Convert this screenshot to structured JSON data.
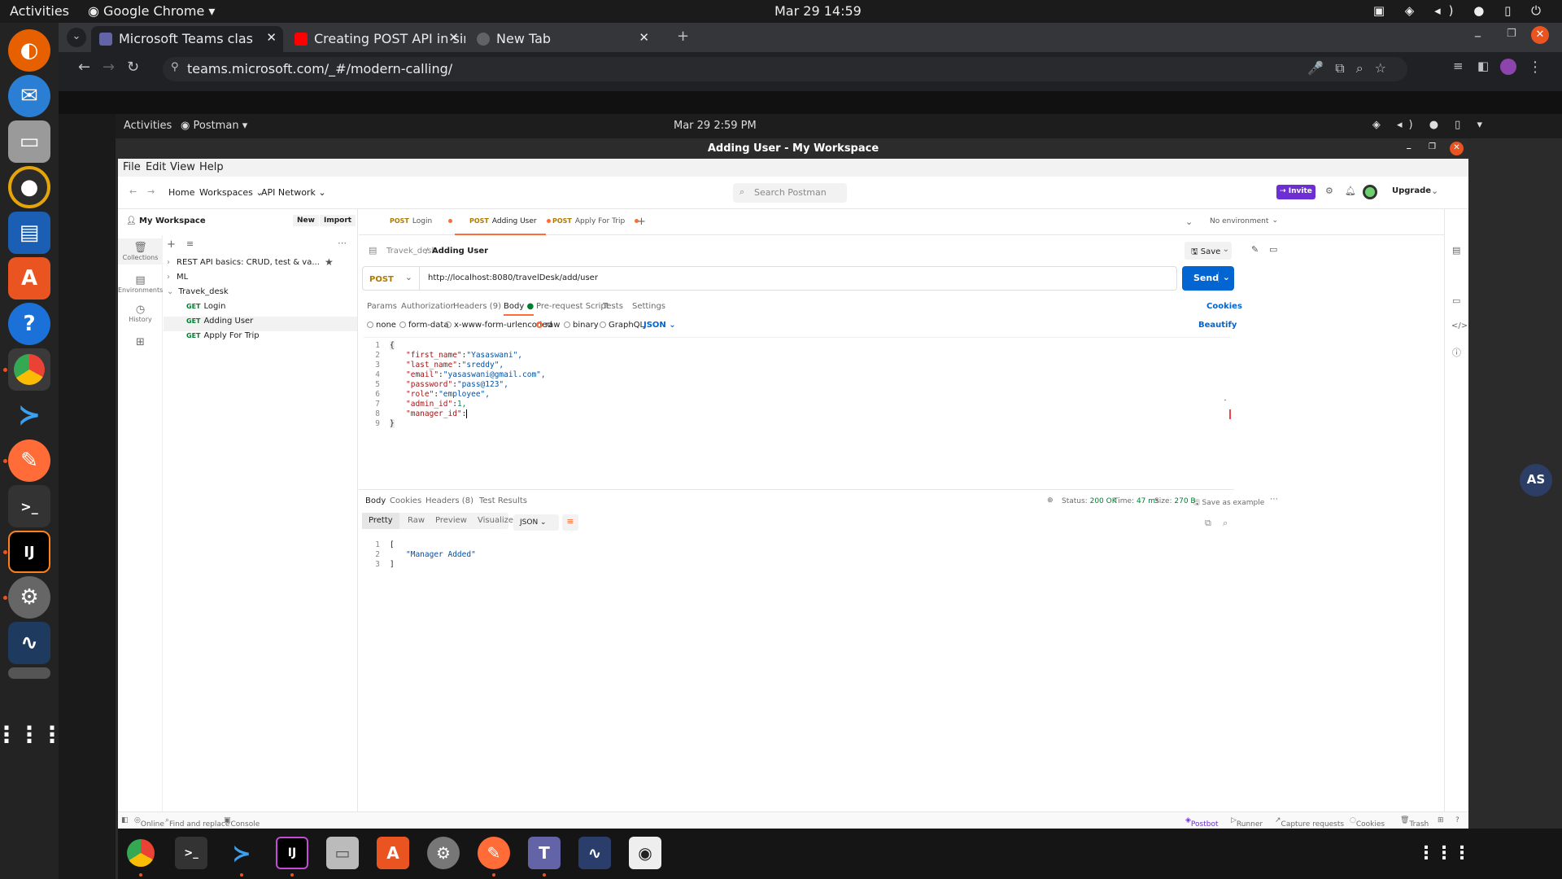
{
  "os": {
    "activities": "Activities",
    "app_name": "Google Chrome",
    "clock": "Mar 29  14:59"
  },
  "chrome": {
    "tabs": [
      {
        "title": "Microsoft Teams clas",
        "favicon_color": "#6264a7"
      },
      {
        "title": "Creating POST API in sim",
        "favicon_color": "#ff0000"
      },
      {
        "title": "New Tab",
        "favicon_color": "#5f6368"
      }
    ],
    "url": "teams.microsoft.com/_#/modern-calling/"
  },
  "vm": {
    "activities": "Activities",
    "app_name": "Postman",
    "clock": "Mar 29  2:59 PM"
  },
  "postman": {
    "window_title": "Adding User - My Workspace",
    "menu": [
      "File",
      "Edit",
      "View",
      "Help"
    ],
    "header": {
      "home": "Home",
      "workspaces": "Workspaces",
      "api_network": "API Network",
      "search_placeholder": "Search Postman",
      "invite": "Invite",
      "upgrade": "Upgrade"
    },
    "sidebar": {
      "workspace": "My Workspace",
      "new": "New",
      "import": "Import",
      "rail": [
        "Collections",
        "Environments",
        "History"
      ],
      "collections": [
        {
          "name": "REST API basics: CRUD, test & va...",
          "expanded": false
        },
        {
          "name": "ML",
          "expanded": false
        },
        {
          "name": "Travek_desk",
          "expanded": true
        }
      ],
      "requests": [
        {
          "method": "GET",
          "name": "Login"
        },
        {
          "method": "GET",
          "name": "Adding User"
        },
        {
          "method": "GET",
          "name": "Apply For Trip"
        }
      ]
    },
    "tabs": [
      {
        "method": "POST",
        "name": "Login"
      },
      {
        "method": "POST",
        "name": "Adding User"
      },
      {
        "method": "POST",
        "name": "Apply For Trip"
      }
    ],
    "environment": "No environment",
    "breadcrumb": {
      "collection": "Travek_desk",
      "request": "Adding User"
    },
    "save": "Save",
    "request": {
      "method": "POST",
      "url": "http://localhost:8080/travelDesk/add/user",
      "send": "Send"
    },
    "request_tabs": [
      "Params",
      "Authorization",
      "Headers (9)",
      "Body",
      "Pre-request Script",
      "Tests",
      "Settings"
    ],
    "cookies": "Cookies",
    "body_types": [
      "none",
      "form-data",
      "x-www-form-urlencoded",
      "raw",
      "binary",
      "GraphQL"
    ],
    "body_format": "JSON",
    "beautify": "Beautify",
    "body_lines": [
      {
        "n": "1",
        "text": "{"
      },
      {
        "n": "2",
        "key": "\"first_name\"",
        "val": "\"Yasaswani\","
      },
      {
        "n": "3",
        "key": "\"last_name\"",
        "val": "\"sreddy\","
      },
      {
        "n": "4",
        "key": "\"email\"",
        "val": "\"yasaswani@gmail.com\","
      },
      {
        "n": "5",
        "key": "\"password\"",
        "val": "\"pass@123\","
      },
      {
        "n": "6",
        "key": "\"role\"",
        "val": "\"employee\","
      },
      {
        "n": "7",
        "key": "\"admin_id\"",
        "val": "1,"
      },
      {
        "n": "8",
        "key": "\"manager_id\"",
        "val": ""
      },
      {
        "n": "9",
        "text": "}"
      }
    ],
    "response": {
      "tabs": [
        "Body",
        "Cookies",
        "Headers (8)",
        "Test Results"
      ],
      "status_label": "Status:",
      "status": "200 OK",
      "time_label": "Time:",
      "time": "47 ms",
      "size_label": "Size:",
      "size": "270 B",
      "save_example": "Save as example",
      "view_tabs": [
        "Pretty",
        "Raw",
        "Preview",
        "Visualize"
      ],
      "format": "JSON",
      "lines": [
        {
          "n": "1",
          "text": "["
        },
        {
          "n": "2",
          "text": "\"Manager Added\""
        },
        {
          "n": "3",
          "text": "]"
        }
      ]
    },
    "status_bar": {
      "online": "Online",
      "find": "Find and replace",
      "console": "Console",
      "postbot": "Postbot",
      "runner": "Runner",
      "capture": "Capture requests",
      "cookies": "Cookies",
      "trash": "Trash"
    },
    "avatar": "AS"
  },
  "colors": {
    "postman_orange": "#ff6c37",
    "send_blue": "#0265d2",
    "invite_purple": "#6d2ed3",
    "status_green": "#007f31"
  }
}
